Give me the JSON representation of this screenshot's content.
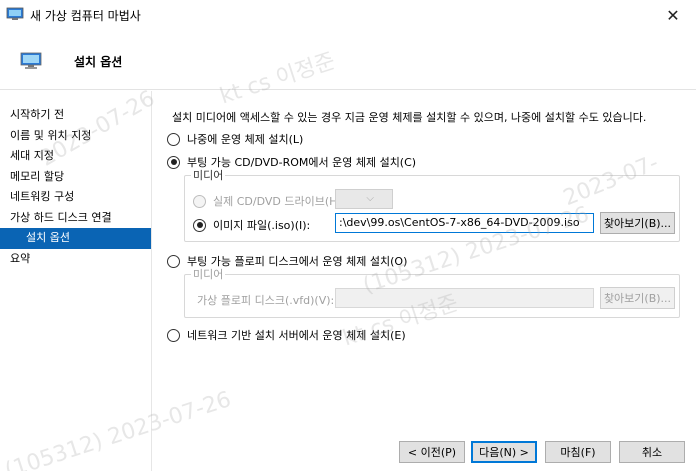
{
  "window": {
    "title": "새 가상 컴퓨터 마법사",
    "close_glyph": "✕"
  },
  "header": {
    "title": "설치 옵션"
  },
  "sidebar": {
    "items": [
      {
        "label": "시작하기 전"
      },
      {
        "label": "이름 및 위치 지정"
      },
      {
        "label": "세대 지정"
      },
      {
        "label": "메모리 할당"
      },
      {
        "label": "네트워킹 구성"
      },
      {
        "label": "가상 하드 디스크 연결"
      },
      {
        "label": "설치 옵션"
      },
      {
        "label": "요약"
      }
    ],
    "active_item": "설치 옵션"
  },
  "main": {
    "description": "설치 미디어에 액세스할 수 있는 경우 지금 운영 체제를 설치할 수 있으며, 나중에 설치할 수도 있습니다.",
    "option_later": "나중에 운영 체제 설치(L)",
    "option_cd": "부팅 가능 CD/DVD-ROM에서 운영 체제 설치(C)",
    "media_legend": "미디어",
    "physical_drive_label": "실제 CD/DVD 드라이브(H):",
    "image_file_label": "이미지 파일(.iso)(I):",
    "image_file_value": ":\\dev\\99.os\\CentOS-7-x86_64-DVD-2009.iso",
    "browse_label": "찾아보기(B)...",
    "option_floppy": "부팅 가능 플로피 디스크에서 운영 체제 설치(O)",
    "floppy_media_legend": "미디어",
    "floppy_file_label": "가상 플로피 디스크(.vfd)(V):",
    "floppy_file_value": "",
    "floppy_browse_label": "찾아보기(B)...",
    "option_network": "네트워크 기반 설치 서버에서 운영 체제 설치(E)",
    "selected_option": "option_cd"
  },
  "footer": {
    "back_label": "< 이전(P)",
    "next_label": "다음(N) >",
    "finish_label": "마침(F)",
    "cancel_label": "취소"
  },
  "watermark": {
    "text_1": "kt cs 이정준",
    "text_2": "kt cs 이정준",
    "text_3": "(105312) 2023-07-26",
    "text_4": "(105312) 2023-07-26",
    "text_5": "2023-07-26",
    "text_6": "2023-07-"
  },
  "icons": {
    "app": "vm-wizard-icon",
    "header": "monitor-icon",
    "close": "close-icon",
    "dropdown": "chevron-down-icon"
  },
  "colors": {
    "accent": "#0078d7",
    "sidebar_active": "#0a64b4"
  }
}
